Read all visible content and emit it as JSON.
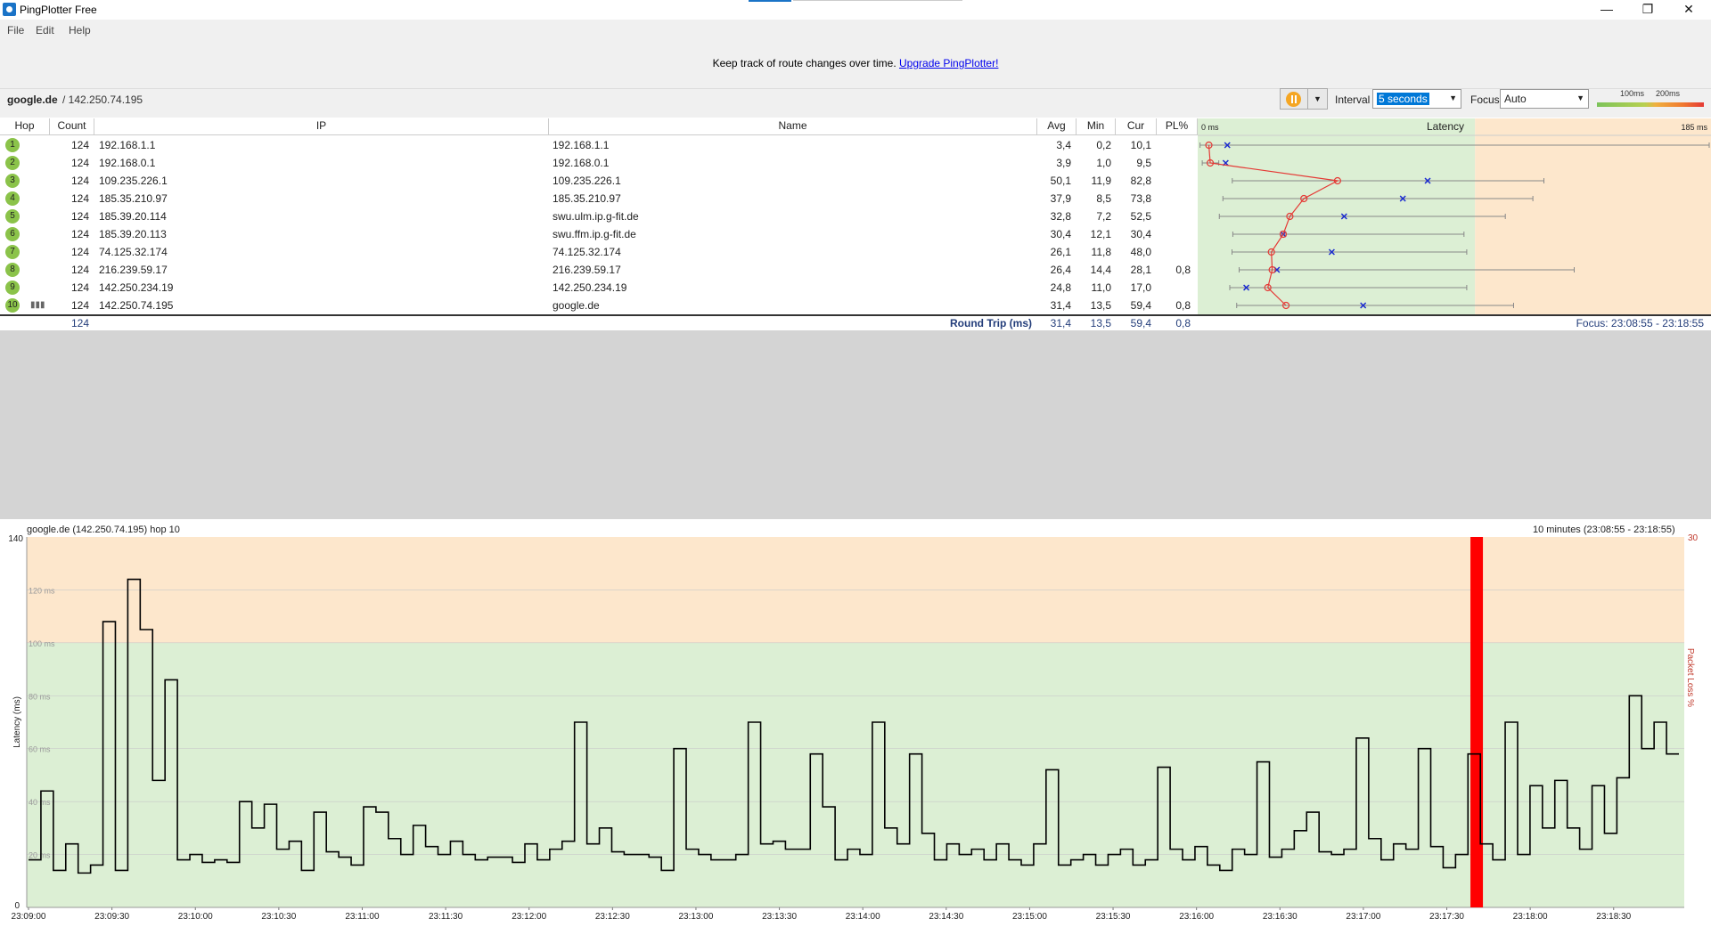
{
  "window": {
    "title": "PingPlotter Free",
    "minimize": "—",
    "restore": "❐",
    "close": "✕"
  },
  "menu": [
    "File",
    "Edit",
    "Help"
  ],
  "banner": {
    "text": "Keep track of route changes over time.",
    "link": "Upgrade PingPlotter!"
  },
  "target": {
    "host": "google.de",
    "separator_ip": "/ 142.250.74.195"
  },
  "toolbar": {
    "interval_label": "Interval",
    "interval_value": "5 seconds",
    "focus_label": "Focus",
    "focus_value": "Auto",
    "scale_100": "100ms",
    "scale_200": "200ms"
  },
  "columns": {
    "hop": "Hop",
    "count": "Count",
    "ip": "IP",
    "name": "Name",
    "avg": "Avg",
    "min": "Min",
    "cur": "Cur",
    "pl": "PL%",
    "latency": "Latency",
    "lat_min": "0 ms",
    "lat_max": "185 ms"
  },
  "hops": [
    {
      "hop": "1",
      "count": "124",
      "ip": "192.168.1.1",
      "name": "192.168.1.1",
      "avg": "3,4",
      "min": "0,2",
      "cur": "10,1",
      "pl": "",
      "avg_v": 3.4,
      "min_v": 0.2,
      "cur_v": 10.1,
      "max_v": 185
    },
    {
      "hop": "2",
      "count": "124",
      "ip": "192.168.0.1",
      "name": "192.168.0.1",
      "avg": "3,9",
      "min": "1,0",
      "cur": "9,5",
      "pl": "",
      "avg_v": 3.9,
      "min_v": 1.0,
      "cur_v": 9.5,
      "max_v": 7
    },
    {
      "hop": "3",
      "count": "124",
      "ip": "109.235.226.1",
      "name": "109.235.226.1",
      "avg": "50,1",
      "min": "11,9",
      "cur": "82,8",
      "pl": "",
      "avg_v": 50.1,
      "min_v": 11.9,
      "cur_v": 82.8,
      "max_v": 125
    },
    {
      "hop": "4",
      "count": "124",
      "ip": "185.35.210.97",
      "name": "185.35.210.97",
      "avg": "37,9",
      "min": "8,5",
      "cur": "73,8",
      "pl": "",
      "avg_v": 37.9,
      "min_v": 8.5,
      "cur_v": 73.8,
      "max_v": 121
    },
    {
      "hop": "5",
      "count": "124",
      "ip": "185.39.20.114",
      "name": "swu.ulm.ip.g-fit.de",
      "avg": "32,8",
      "min": "7,2",
      "cur": "52,5",
      "pl": "",
      "avg_v": 32.8,
      "min_v": 7.2,
      "cur_v": 52.5,
      "max_v": 111
    },
    {
      "hop": "6",
      "count": "124",
      "ip": "185.39.20.113",
      "name": "swu.ffm.ip.g-fit.de",
      "avg": "30,4",
      "min": "12,1",
      "cur": "30,4",
      "pl": "",
      "avg_v": 30.4,
      "min_v": 12.1,
      "cur_v": 30.4,
      "max_v": 96
    },
    {
      "hop": "7",
      "count": "124",
      "ip": "74.125.32.174",
      "name": "74.125.32.174",
      "avg": "26,1",
      "min": "11,8",
      "cur": "48,0",
      "pl": "",
      "avg_v": 26.1,
      "min_v": 11.8,
      "cur_v": 48.0,
      "max_v": 97
    },
    {
      "hop": "8",
      "count": "124",
      "ip": "216.239.59.17",
      "name": "216.239.59.17",
      "avg": "26,4",
      "min": "14,4",
      "cur": "28,1",
      "pl": "0,8",
      "avg_v": 26.4,
      "min_v": 14.4,
      "cur_v": 28.1,
      "max_v": 136
    },
    {
      "hop": "9",
      "count": "124",
      "ip": "142.250.234.19",
      "name": "142.250.234.19",
      "avg": "24,8",
      "min": "11,0",
      "cur": "17,0",
      "pl": "",
      "avg_v": 24.8,
      "min_v": 11.0,
      "cur_v": 17.0,
      "max_v": 97
    },
    {
      "hop": "10",
      "count": "124",
      "ip": "142.250.74.195",
      "name": "google.de",
      "avg": "31,4",
      "min": "13,5",
      "cur": "59,4",
      "pl": "0,8",
      "avg_v": 31.4,
      "min_v": 13.5,
      "cur_v": 59.4,
      "max_v": 114
    }
  ],
  "totals": {
    "count": "124",
    "label": "Round Trip (ms)",
    "avg": "31,4",
    "min": "13,5",
    "cur": "59,4",
    "pl": "0,8",
    "focus": "Focus: 23:08:55 - 23:18:55"
  },
  "graph": {
    "title": "google.de (142.250.74.195) hop 10",
    "range": "10 minutes (23:08:55 - 23:18:55)",
    "ylabel": "Latency (ms)",
    "ylabel_right": "Packet Loss %",
    "right_top": "30",
    "y_top": "140",
    "y_zero": "0",
    "y_grid_labels": [
      "120 ms",
      "100 ms",
      "80 ms",
      "60 ms",
      "40 ms",
      "20 ms"
    ],
    "x_labels": [
      "23:09:00",
      "23:09:30",
      "23:10:00",
      "23:10:30",
      "23:11:00",
      "23:11:30",
      "23:12:00",
      "23:12:30",
      "23:13:00",
      "23:13:30",
      "23:14:00",
      "23:14:30",
      "23:15:00",
      "23:15:30",
      "23:16:00",
      "23:16:30",
      "23:17:00",
      "23:17:30",
      "23:18:00",
      "23:18:30"
    ],
    "loss_at": 0.871,
    "zones": {
      "green_max": 100,
      "orange_max": 140
    },
    "colors": {
      "green": "#dcefd4",
      "orange": "#fde7cc",
      "loss": "#ff0000",
      "avg_line": "#e53935"
    }
  },
  "chart_data": {
    "type": "line",
    "xlabel": "",
    "ylabel": "Latency (ms)",
    "ylim": [
      0,
      140
    ],
    "series": [
      {
        "values": [
          18,
          44,
          14,
          24,
          13,
          16,
          108,
          14,
          124,
          105,
          48,
          86,
          18,
          20,
          17,
          18,
          17,
          40,
          30,
          39,
          22,
          25,
          14,
          36,
          21,
          19,
          16,
          38,
          36,
          26,
          20,
          31,
          23,
          20,
          25,
          20,
          18,
          19,
          19,
          17,
          24,
          18,
          22,
          25,
          70,
          24,
          30,
          21,
          20,
          20,
          19,
          14,
          60,
          22,
          20,
          18,
          18,
          20,
          70,
          24,
          25,
          22,
          22,
          58,
          38,
          18,
          22,
          20,
          70,
          30,
          24,
          58,
          28,
          18,
          24,
          20,
          22,
          18,
          24,
          18,
          16,
          24,
          52,
          16,
          18,
          20,
          16,
          20,
          22,
          16,
          18,
          53,
          22,
          18,
          23,
          16,
          14,
          22,
          20,
          55,
          19,
          22,
          29,
          36,
          21,
          20,
          22,
          64,
          26,
          18,
          24,
          22,
          60,
          23,
          15,
          20,
          58,
          24,
          18,
          70,
          20,
          46,
          30,
          48,
          30,
          22,
          46,
          28,
          49,
          80,
          60,
          70,
          58
        ]
      }
    ]
  }
}
